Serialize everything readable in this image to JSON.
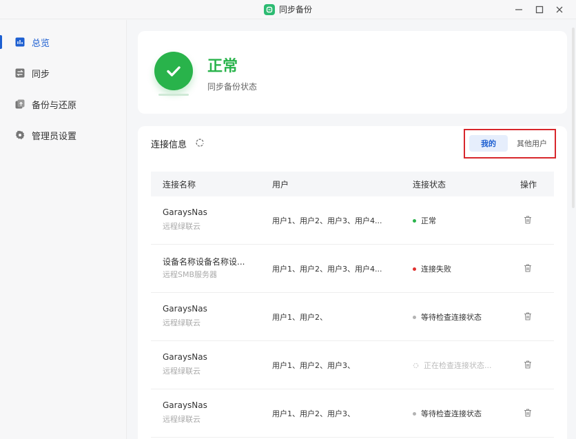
{
  "window": {
    "title": "同步备份"
  },
  "sidebar": {
    "items": [
      {
        "label": "总览",
        "icon": "chart-icon",
        "active": true
      },
      {
        "label": "同步",
        "icon": "sync-icon",
        "active": false
      },
      {
        "label": "备份与还原",
        "icon": "backup-icon",
        "active": false
      },
      {
        "label": "管理员设置",
        "icon": "gear-icon",
        "active": false
      }
    ]
  },
  "status": {
    "title": "正常",
    "subtitle": "同步备份状态"
  },
  "connections": {
    "title": "连接信息",
    "tabs": {
      "mine": "我的",
      "others": "其他用户"
    },
    "columns": {
      "name": "连接名称",
      "user": "用户",
      "state": "连接状态",
      "action": "操作"
    },
    "rows": [
      {
        "name": "GaraysNas",
        "type": "远程绿联云",
        "users": "用户1、用户2、用户3、用户4...",
        "state": "正常",
        "state_color": "#29b34b"
      },
      {
        "name": "设备名称设备名称设...",
        "type": "远程SMB服务器",
        "users": "用户1、用户2、用户3、用户4...",
        "state": "连接失败",
        "state_color": "#e0312f"
      },
      {
        "name": "GaraysNas",
        "type": "远程绿联云",
        "users": "用户1、用户2、",
        "state": "等待检查连接状态",
        "state_color": "#b3b3b3"
      },
      {
        "name": "GaraysNas",
        "type": "远程绿联云",
        "users": "用户1、用户2、用户3、",
        "state": "正在检查连接状态...",
        "state_color": "#d0d0d0"
      },
      {
        "name": "GaraysNas",
        "type": "远程绿联云",
        "users": "用户1、用户2、用户3、",
        "state": "等待检查连接状态",
        "state_color": "#b3b3b3"
      }
    ]
  },
  "colors": {
    "accent": "#1d5fd1",
    "success": "#29b34b",
    "error": "#e0312f"
  }
}
